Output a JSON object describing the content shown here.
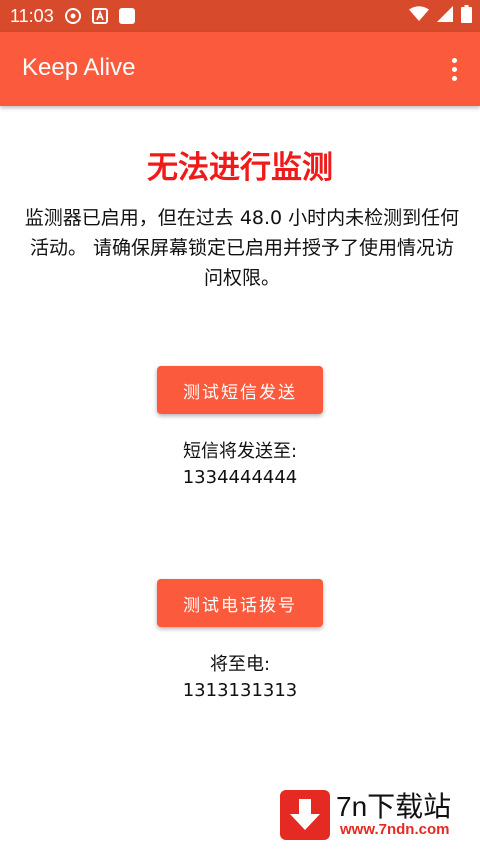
{
  "status_bar": {
    "time": "11:03",
    "icons": [
      "wifi-icon",
      "signal-icon",
      "battery-icon"
    ]
  },
  "app_bar": {
    "title": "Keep Alive",
    "overflow_icon": "more-vert-icon"
  },
  "main": {
    "heading": "无法进行监测",
    "message": "监测器已启用，但在过去 48.0 小时内未检测到任何活动。 请确保屏幕锁定已启用并授予了使用情况访问权限。",
    "sms_button_label": "测试短信发送",
    "sms_label": "短信将发送至:",
    "sms_number": "1334444444",
    "call_button_label": "测试电话拨号",
    "call_label": "将至电:",
    "call_number": "1313131313"
  },
  "watermark": {
    "title": "7n下载站",
    "url": "www.7ndn.com"
  },
  "colors": {
    "status_bar": "#d84a2c",
    "app_bar": "#fb5a3c",
    "heading": "#ef1a1a",
    "button": "#fb5a3c",
    "watermark_red": "#e52a24"
  }
}
